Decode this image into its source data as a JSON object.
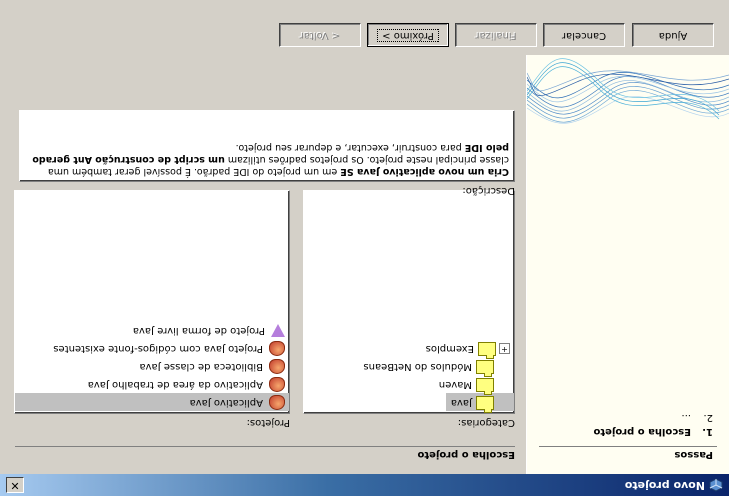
{
  "window": {
    "title": "Novo projeto",
    "close_glyph": "✕"
  },
  "steps_panel": {
    "heading": "Passos",
    "steps": [
      {
        "number": "1.",
        "label": "Escolha o projeto",
        "current": true
      },
      {
        "number": "2.",
        "label": "...",
        "current": false
      }
    ]
  },
  "content": {
    "heading": "Escolha o projeto",
    "categories_label": "Categorias:",
    "projects_label": "Projetos:",
    "description_label": "Descrição:",
    "categories": [
      {
        "label": "Java",
        "icon": "folder-icon",
        "selected": true,
        "expandable": false
      },
      {
        "label": "Maven",
        "icon": "folder-icon",
        "selected": false,
        "expandable": false
      },
      {
        "label": "Módulos do NetBeans",
        "icon": "folder-icon",
        "selected": false,
        "expandable": false
      },
      {
        "label": "Exemplos",
        "icon": "folder-icon",
        "selected": false,
        "expandable": true
      }
    ],
    "projects": [
      {
        "label": "Aplicativo Java",
        "icon": "java-coffee-icon",
        "selected": true
      },
      {
        "label": "Aplicativo da área de trabalho Java",
        "icon": "java-coffee-icon",
        "selected": false
      },
      {
        "label": "Biblioteca de classe Java",
        "icon": "java-coffee-icon",
        "selected": false
      },
      {
        "label": "Projeto Java com códigos-fonte existentes",
        "icon": "java-coffee-icon",
        "selected": false
      },
      {
        "label": "Projeto de forma livre Java",
        "icon": "freeform-icon",
        "selected": false
      }
    ],
    "description": {
      "part1": "Cria um novo aplicativo Java SE",
      "part2": " em um projeto do IDE padrão. É possível gerar também uma classe principal neste projeto. Os projetos padrões utilizam ",
      "part3": "um script de construção Ant gerado pelo IDE",
      "part4": " para construir, executar, e depurar seu projeto."
    }
  },
  "buttons": {
    "back": "< Voltar",
    "next": "Próximo >",
    "finish": "Finalizar",
    "cancel": "Cancelar",
    "help": "Ajuda"
  },
  "colors": {
    "titlebar_start": "#0a246a",
    "titlebar_end": "#a6caf0",
    "dialog_bg": "#d4d0c8",
    "steps_bg": "#fffef2"
  }
}
